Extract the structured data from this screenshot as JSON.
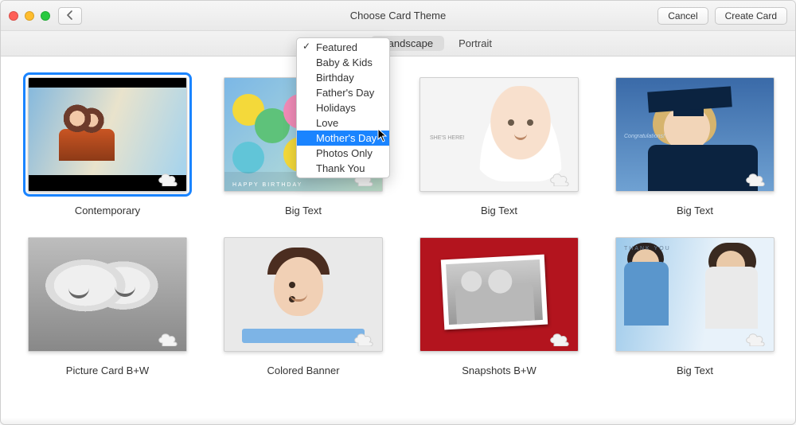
{
  "window": {
    "title": "Choose Card Theme",
    "buttons": {
      "cancel": "Cancel",
      "create": "Create Card"
    }
  },
  "toolbar": {
    "category_selected": "Featured",
    "orientation_landscape": "Landscape",
    "orientation_portrait": "Portrait"
  },
  "dropdown": {
    "items": [
      "Featured",
      "Baby & Kids",
      "Birthday",
      "Father's Day",
      "Holidays",
      "Love",
      "Mother's Day",
      "Photos Only",
      "Thank You"
    ],
    "checked_index": 0,
    "highlighted_index": 6
  },
  "themes": {
    "row1": [
      {
        "label": "Contemporary",
        "selected": true,
        "cloud": true
      },
      {
        "label": "Big Text",
        "selected": false,
        "cloud": true,
        "overlay_text": "HAPPY BIRTHDAY"
      },
      {
        "label": "Big Text",
        "selected": false,
        "cloud": true,
        "overlay_text": "SHE'S HERE!"
      },
      {
        "label": "Big Text",
        "selected": false,
        "cloud": true,
        "overlay_text": "Congratulations!"
      }
    ],
    "row2": [
      {
        "label": "Picture Card B+W",
        "selected": false,
        "cloud": true
      },
      {
        "label": "Colored Banner",
        "selected": false,
        "cloud": true
      },
      {
        "label": "Snapshots B+W",
        "selected": false,
        "cloud": true
      },
      {
        "label": "Big Text",
        "selected": false,
        "cloud": true,
        "overlay_text": "THANK YOU"
      }
    ]
  }
}
